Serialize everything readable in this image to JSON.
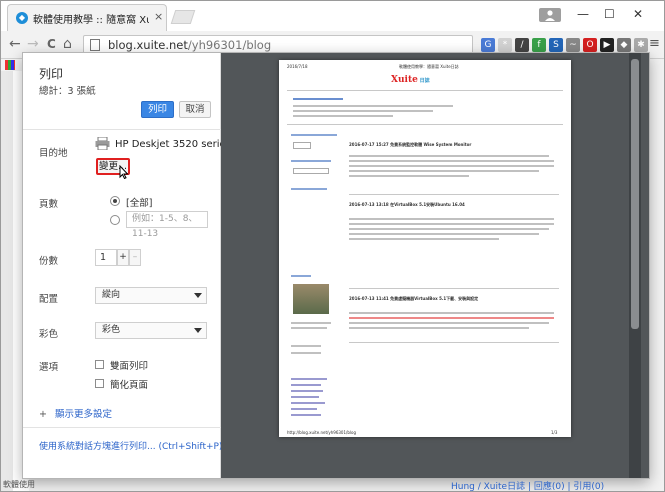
{
  "browser": {
    "tab_title": "軟體使用教學 :: 隨意窩 Xu",
    "tab_close": "×",
    "user_badge": "",
    "url_host": "blog.xuite.net",
    "url_path": "/yh96301/blog",
    "window_controls": [
      "—",
      "☐",
      "✕"
    ],
    "nav": [
      "←",
      "→",
      "C",
      "⌂"
    ],
    "menu_icon": "≡"
  },
  "extensions": [
    {
      "name": "translate-icon",
      "color": "#4a7bd6",
      "glyph": "G"
    },
    {
      "name": "lastpass-icon",
      "color": "#d2d2d2",
      "glyph": "*"
    },
    {
      "name": "pen-icon",
      "color": "#444444",
      "glyph": "/"
    },
    {
      "name": "feedly-icon",
      "color": "#3aa04a",
      "glyph": "f"
    },
    {
      "name": "screenshot-icon",
      "color": "#2366b8",
      "glyph": "S"
    },
    {
      "name": "tool-icon",
      "color": "#888888",
      "glyph": "~"
    },
    {
      "name": "opera-icon",
      "color": "#d42020",
      "glyph": "O"
    },
    {
      "name": "play-icon",
      "color": "#222222",
      "glyph": "▶"
    },
    {
      "name": "shield-icon",
      "color": "#777777",
      "glyph": "◆"
    },
    {
      "name": "puzzle-icon",
      "color": "#aaaaaa",
      "glyph": "✱"
    }
  ],
  "print": {
    "title": "列印",
    "total": "總計：3 張紙",
    "print_label": "列印",
    "cancel_label": "取消",
    "destination_label": "目的地",
    "printer_name": "HP Deskjet 3520 series (...",
    "change_label": "變更...",
    "pages_label": "頁數",
    "pages_all": "全部",
    "pages_placeholder": "例如：1-5、8、11-13",
    "copies_label": "份數",
    "copies_value": "1",
    "copies_plus": "+",
    "copies_minus": "–",
    "layout_label": "配置",
    "layout_value": "縱向",
    "color_label": "彩色",
    "color_value": "彩色",
    "options_label": "選項",
    "option_two_sided": "雙面列印",
    "option_two_sided_checked": false,
    "option_simplify": "簡化頁面",
    "option_simplify_checked": false,
    "more_settings": "顯示更多設定",
    "system_dialog": "使用系統對話方塊進行列印... (Ctrl+Shift+P)"
  },
  "preview": {
    "date": "2016/7/18",
    "site_title": "軟體使用教學：隨意窩 Xuite日誌",
    "footer_url": "http://blog.xuite.net/yh96301/blog",
    "page_num": "1/3",
    "posts": [
      "2016-07-17 15:27 免費系統監控軟體 Wise System Monitor",
      "2016-07-13 13:18 在VirtualBox 5.1安裝Ubuntu 16.04",
      "2016-07-13 11:41 免費虛擬機器VirtualBox 5.1下載、安裝與設定"
    ]
  },
  "background_page": {
    "footer_text": "Hung / Xuite日誌 | 回應(0) | 引用(0)",
    "bottom_left": "軟體使用"
  }
}
